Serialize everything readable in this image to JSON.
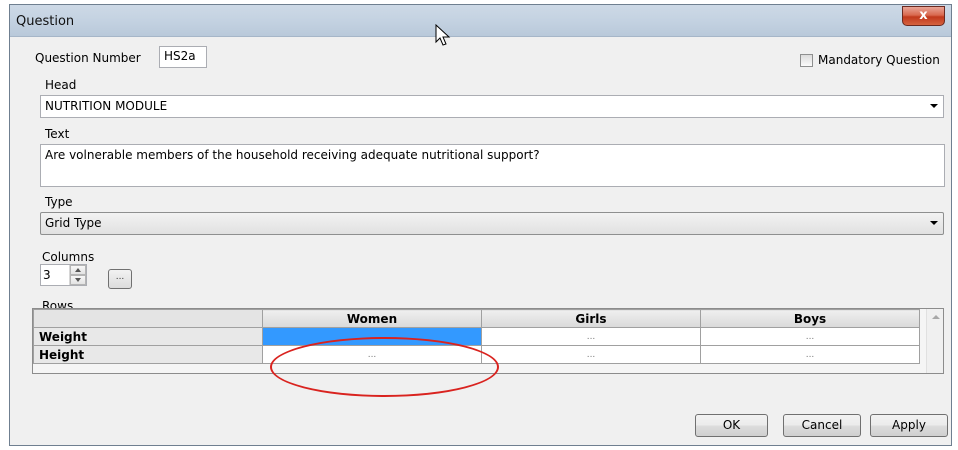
{
  "window": {
    "title": "Question",
    "close_label": "x"
  },
  "question_number": {
    "label": "Question Number",
    "value": "HS2a"
  },
  "mandatory": {
    "label": "Mandatory Question",
    "checked": false
  },
  "head": {
    "label": "Head",
    "value": "NUTRITION MODULE"
  },
  "text": {
    "label": "Text",
    "value": "Are volnerable members of the household receiving adequate nutritional support?"
  },
  "type": {
    "label": "Type",
    "value": "Grid Type"
  },
  "columns": {
    "label": "Columns",
    "value": "3",
    "button_label": "..."
  },
  "rows": {
    "label": "Rows",
    "value": "2",
    "button_label": "..."
  },
  "grid": {
    "columns": [
      "Women",
      "Girls",
      "Boys"
    ],
    "rows": [
      {
        "label": "Weight",
        "cells": [
          "...",
          "...",
          "..."
        ]
      },
      {
        "label": "Height",
        "cells": [
          "...",
          "...",
          "..."
        ]
      }
    ],
    "selected_cell": "Weight/Women"
  },
  "buttons": {
    "ok": "OK",
    "cancel": "Cancel",
    "apply": "Apply"
  },
  "colors": {
    "selection": "#3399ff",
    "annotation_circle": "#d9231f"
  }
}
